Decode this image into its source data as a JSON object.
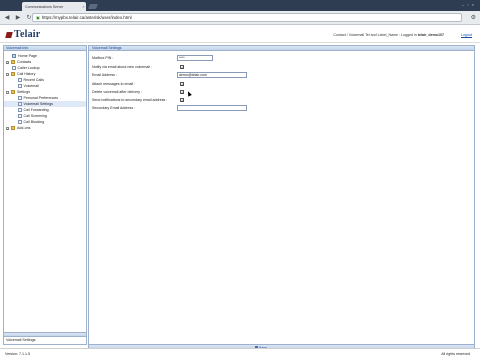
{
  "browser": {
    "tab_title": "Communications Server",
    "tab_close": "×",
    "url": "https://mypbx.telair.ca/asterisk/user/index.html",
    "back_glyph": "◀",
    "forward_glyph": "▶",
    "reload_glyph": "↻",
    "window_buttons": [
      "–",
      "▫",
      "×"
    ]
  },
  "header": {
    "logo_text": "Telair",
    "user_prefix": "Contact / Voicemail Tel and Label_Name : Logged in ",
    "user_name": "telair_demo107",
    "logout_label": "Logout"
  },
  "sidebar": {
    "title": "Voicemail Info",
    "items": [
      {
        "label": "Home Page",
        "expander": ""
      },
      {
        "label": "Contacts",
        "expander": "+"
      },
      {
        "label": "Caller Lookup",
        "expander": ""
      },
      {
        "label": "Call History",
        "expander": "−"
      },
      {
        "label": "Recent Calls",
        "expander": ""
      },
      {
        "label": "Voicemail",
        "expander": ""
      },
      {
        "label": "Settings",
        "expander": "−"
      },
      {
        "label": "Personal Preferences",
        "expander": ""
      },
      {
        "label": "Voicemail Settings",
        "expander": ""
      },
      {
        "label": "Call Forwarding",
        "expander": ""
      },
      {
        "label": "Call Screening",
        "expander": ""
      },
      {
        "label": "Call Blocking",
        "expander": ""
      },
      {
        "label": "Add-ons",
        "expander": "+"
      }
    ],
    "footer_label": "Voicemail Settings"
  },
  "main": {
    "title": "Voicemail Settings",
    "fields": [
      {
        "label": "Mailbox PIN :",
        "type": "text",
        "value": "****"
      },
      {
        "label": "Notify via email about new voicemail :",
        "type": "check",
        "checked": "✓"
      },
      {
        "label": "Email Address :",
        "type": "text",
        "value": "demo@telair.com"
      },
      {
        "label": "Attach messages to email :",
        "type": "check",
        "checked": "✓"
      },
      {
        "label": "Delete voicemail after delivery :",
        "type": "check",
        "checked": "✓"
      },
      {
        "label": "Send notifications to secondary email address :",
        "type": "check",
        "checked": "✓"
      },
      {
        "label": "Secondary Email Address :",
        "type": "text",
        "value": ""
      }
    ],
    "save_label": "Save"
  },
  "status": {
    "version": "Version: 7.1.1.5",
    "rights": "All rights reserved"
  },
  "colors": {
    "panel_header": "#c3d4ea",
    "panel_border": "#9db1cc",
    "selection": "#dfe8f6",
    "logo_blue": "#1f3a63",
    "logo_red": "#8a1c1c"
  }
}
